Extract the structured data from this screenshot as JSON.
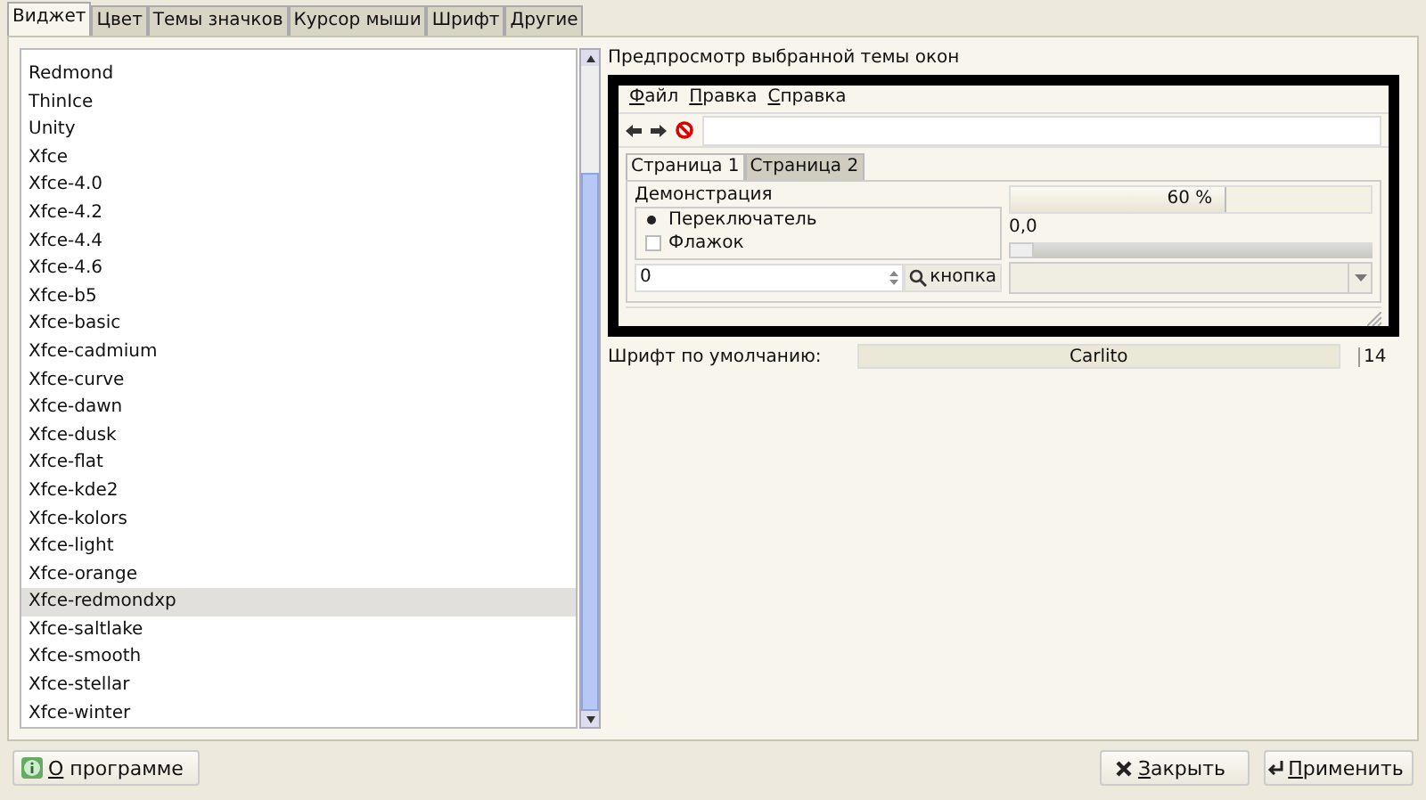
{
  "tabs": [
    {
      "label": "Виджет",
      "selected": true
    },
    {
      "label": "Цвет",
      "selected": false
    },
    {
      "label": "Темы значков",
      "selected": false
    },
    {
      "label": "Курсор мыши",
      "selected": false
    },
    {
      "label": "Шрифт",
      "selected": false
    },
    {
      "label": "Другие",
      "selected": false
    }
  ],
  "theme_list": {
    "items": [
      {
        "label": "Redmond",
        "selected": false
      },
      {
        "label": "ThinIce",
        "selected": false
      },
      {
        "label": "Unity",
        "selected": false
      },
      {
        "label": "Xfce",
        "selected": false
      },
      {
        "label": "Xfce-4.0",
        "selected": false
      },
      {
        "label": "Xfce-4.2",
        "selected": false
      },
      {
        "label": "Xfce-4.4",
        "selected": false
      },
      {
        "label": "Xfce-4.6",
        "selected": false
      },
      {
        "label": "Xfce-b5",
        "selected": false
      },
      {
        "label": "Xfce-basic",
        "selected": false
      },
      {
        "label": "Xfce-cadmium",
        "selected": false
      },
      {
        "label": "Xfce-curve",
        "selected": false
      },
      {
        "label": "Xfce-dawn",
        "selected": false
      },
      {
        "label": "Xfce-dusk",
        "selected": false
      },
      {
        "label": "Xfce-flat",
        "selected": false
      },
      {
        "label": "Xfce-kde2",
        "selected": false
      },
      {
        "label": "Xfce-kolors",
        "selected": false
      },
      {
        "label": "Xfce-light",
        "selected": false
      },
      {
        "label": "Xfce-orange",
        "selected": false
      },
      {
        "label": "Xfce-redmondxp",
        "selected": true
      },
      {
        "label": "Xfce-saltlake",
        "selected": false
      },
      {
        "label": "Xfce-smooth",
        "selected": false
      },
      {
        "label": "Xfce-stellar",
        "selected": false
      },
      {
        "label": "Xfce-winter",
        "selected": false
      }
    ]
  },
  "preview": {
    "title": "Предпросмотр выбранной темы окон",
    "menu": [
      "Файл",
      "Правка",
      "Справка"
    ],
    "tabs": [
      {
        "label": "Страница 1",
        "selected": true
      },
      {
        "label": "Страница 2",
        "selected": false
      }
    ],
    "group_label": "Демонстрация",
    "radio": {
      "label": "Переключатель",
      "selected": true
    },
    "checkbox": {
      "label": "Флажок",
      "checked": false
    },
    "spin": {
      "value": "0"
    },
    "button": "кнопка",
    "progress": {
      "level": 0.6,
      "text": "60 %"
    },
    "scale": {
      "value": "0,0",
      "level": 0
    }
  },
  "font": {
    "label": "Шрифт по умолчанию:",
    "value": "Carlito",
    "size": "14"
  },
  "buttons": {
    "about": "О программе",
    "close": "Закрыть",
    "apply": "Применить"
  }
}
